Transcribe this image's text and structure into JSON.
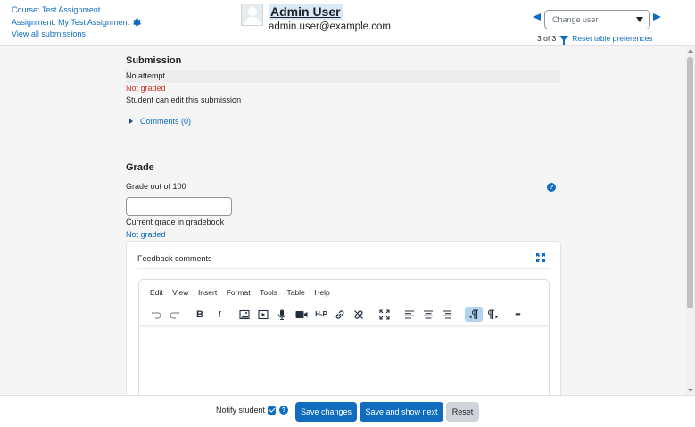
{
  "header": {
    "course_link": "Course: Test Assignment",
    "assignment_link": "Assignment: My Test Assignment",
    "view_all": "View all submissions",
    "user_name": "Admin User",
    "user_email": "admin.user@example.com",
    "change_user_placeholder": "Change user",
    "pager_count": "3 of 3",
    "reset_prefs": "Reset table preferences"
  },
  "submission": {
    "title": "Submission",
    "status": "No attempt",
    "grading_status": "Not graded",
    "edit_status": "Student can edit this submission",
    "comments_label": "Comments (0)"
  },
  "grade": {
    "title": "Grade",
    "grade_out_of": "Grade out of 100",
    "grade_value": "",
    "gradebook_label": "Current grade in gradebook",
    "gradebook_value": "Not graded"
  },
  "feedback": {
    "title": "Feedback comments",
    "menu": [
      "Edit",
      "View",
      "Insert",
      "Format",
      "Tools",
      "Table",
      "Help"
    ],
    "toolbar_icons": [
      "undo-icon",
      "redo-icon",
      "bold-icon",
      "italic-icon",
      "image-icon",
      "media-icon",
      "microphone-icon",
      "video-camera-icon",
      "h5p-icon",
      "link-icon",
      "unlink-icon",
      "fullscreen-icon",
      "align-left-icon",
      "align-center-icon",
      "align-right-icon",
      "ltr-icon",
      "rtl-icon",
      "more-icon"
    ],
    "h5p_label": "H-P",
    "more_label": "•••"
  },
  "footer": {
    "notify_label": "Notify student",
    "notify_checked": true,
    "save_label": "Save changes",
    "save_next_label": "Save and show next",
    "reset_label": "Reset"
  },
  "colors": {
    "accent": "#0f6cbf",
    "danger": "#ca3120",
    "background": "#f5f5f5"
  }
}
